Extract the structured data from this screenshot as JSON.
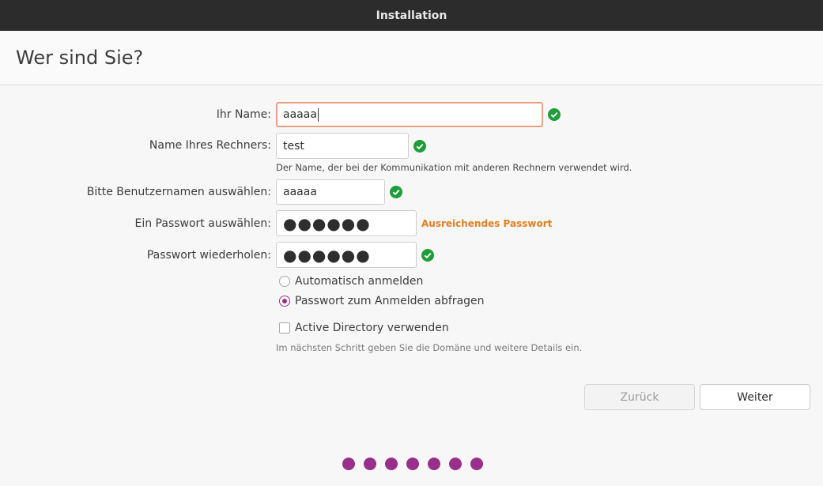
{
  "window": {
    "title": "Installation"
  },
  "page": {
    "title": "Wer sind Sie?"
  },
  "form": {
    "name": {
      "label": "Ihr Name:",
      "value": "aaaaa"
    },
    "computer": {
      "label": "Name Ihres Rechners:",
      "value": "test",
      "hint": "Der Name, der bei der Kommunikation mit anderen Rechnern verwendet wird."
    },
    "username": {
      "label": "Bitte Benutzernamen auswählen:",
      "value": "aaaaa"
    },
    "password": {
      "label": "Ein Passwort auswählen:",
      "value": "●●●●●●",
      "strength": "Ausreichendes Passwort"
    },
    "password_repeat": {
      "label": "Passwort wiederholen:",
      "value": "●●●●●●"
    },
    "login_options": [
      {
        "label": "Automatisch anmelden",
        "selected": false
      },
      {
        "label": "Passwort zum Anmelden abfragen",
        "selected": true
      }
    ],
    "active_directory": {
      "label": "Active Directory verwenden",
      "checked": false,
      "hint": "Im nächsten Schritt geben Sie die Domäne und weitere Details ein."
    }
  },
  "buttons": {
    "back": "Zurück",
    "next": "Weiter"
  },
  "progress": {
    "total": 7,
    "color": "#9a2e8b"
  },
  "colors": {
    "check_ok": "#1e9e3a",
    "strength": "#e67e22",
    "accent": "#9a2e8b"
  }
}
